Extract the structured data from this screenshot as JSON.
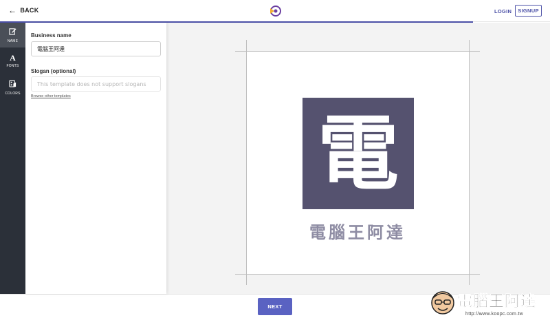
{
  "header": {
    "back_label": "BACK",
    "login_label": "LOGIN",
    "signup_label": "SIGNUP",
    "progress_fraction": 0.86
  },
  "rail": {
    "items": [
      {
        "label": "NAME",
        "icon": "edit-icon",
        "active": true
      },
      {
        "label": "FONTS",
        "icon": "font-icon",
        "active": false
      },
      {
        "label": "COLORS",
        "icon": "palette-icon",
        "active": false
      }
    ]
  },
  "form": {
    "business_name_label": "Business name",
    "business_name_value": "電腦王阿達",
    "slogan_label": "Slogan (optional)",
    "slogan_placeholder": "This template does not support slogans",
    "browse_link": "Browse other templates"
  },
  "preview": {
    "mark_char": "電",
    "business_name": "電腦王阿達",
    "mark_color": "#55526f",
    "name_color": "#8e8ca3"
  },
  "footer": {
    "next_label": "NEXT"
  },
  "watermark": {
    "title": "電腦王阿達",
    "url": "http://www.koopc.com.tw"
  },
  "colors": {
    "accent": "#4a4fa6",
    "button": "#5a62c2",
    "rail_bg": "#2b3039"
  }
}
